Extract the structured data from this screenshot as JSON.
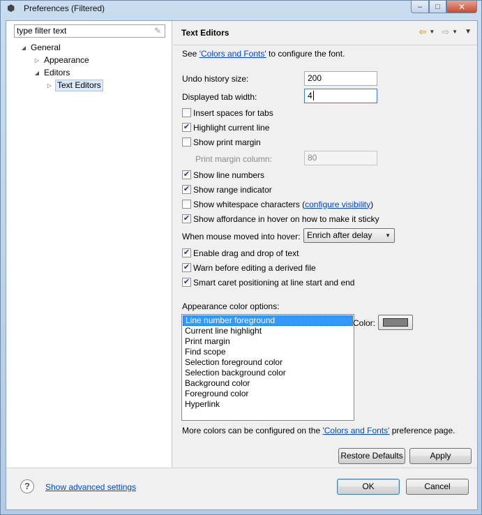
{
  "window": {
    "title": "Preferences (Filtered)",
    "controls": {
      "minimize": "–",
      "maximize": "□",
      "close": "✕"
    }
  },
  "filter": {
    "value": "type filter text"
  },
  "tree": [
    {
      "label": "General",
      "expanded": true
    },
    {
      "label": "Appearance",
      "expanded": false
    },
    {
      "label": "Editors",
      "expanded": true
    },
    {
      "label": "Text Editors",
      "selected": true
    }
  ],
  "page": {
    "title": "Text Editors",
    "font_prefix": "See ",
    "font_link": "'Colors and Fonts'",
    "font_suffix": " to configure the font.",
    "undo_label": "Undo history size:",
    "undo_value": "200",
    "tab_label": "Displayed tab width:",
    "tab_value": "4",
    "checks": {
      "insert_spaces": {
        "label": "Insert spaces for tabs",
        "checked": false
      },
      "highlight_line": {
        "label": "Highlight current line",
        "checked": true
      },
      "print_margin": {
        "label": "Show print margin",
        "checked": false
      },
      "line_numbers": {
        "label": "Show line numbers",
        "checked": true
      },
      "range_indicator": {
        "label": "Show range indicator",
        "checked": true
      },
      "whitespace": {
        "label": "Show whitespace characters",
        "checked": false
      },
      "affordance": {
        "label": "Show affordance in hover on how to make it sticky",
        "checked": true
      },
      "drag_drop": {
        "label": "Enable drag and drop of text",
        "checked": true
      },
      "warn_derived": {
        "label": "Warn before editing a derived file",
        "checked": true
      },
      "smart_caret": {
        "label": "Smart caret positioning at line start and end",
        "checked": true
      }
    },
    "print_margin_label": "Print margin column:",
    "print_margin_value": "80",
    "whitespace_open": "(",
    "whitespace_link": "configure visibility",
    "whitespace_close": ")",
    "hover_label": "When mouse moved into hover:",
    "hover_value": "Enrich after delay",
    "appearance_label": "Appearance color options:",
    "color_options": [
      "Line number foreground",
      "Current line highlight",
      "Print margin",
      "Find scope",
      "Selection foreground color",
      "Selection background color",
      "Background color",
      "Foreground color",
      "Hyperlink"
    ],
    "selected_color_option": 0,
    "color_label": "Color:",
    "color_value": "#808080",
    "more_prefix": "More colors can be configured on the ",
    "more_link": "'Colors and Fonts'",
    "more_suffix": " preference page.",
    "restore_label": "Restore Defaults",
    "apply_label": "Apply"
  },
  "footer": {
    "help_glyph": "?",
    "advanced_link": "Show advanced settings",
    "ok_label": "OK",
    "cancel_label": "Cancel"
  }
}
